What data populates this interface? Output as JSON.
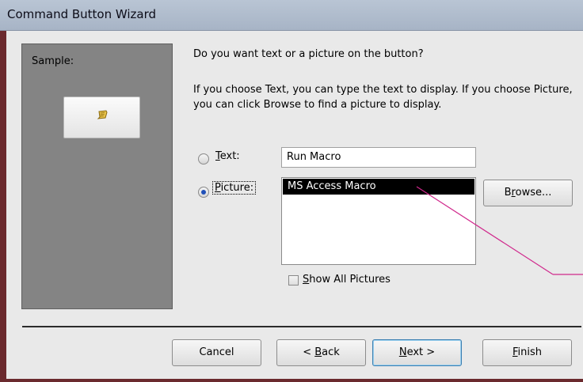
{
  "window": {
    "title": "Command Button Wizard"
  },
  "sample": {
    "label": "Sample:"
  },
  "question": "Do you want text or a picture on the button?",
  "info": "If you choose Text, you can type the text to display.  If you choose Picture, you can click Browse to find a picture to display.",
  "options": {
    "text": {
      "label": "Text:",
      "accel": "T",
      "rest": "ext:",
      "value": "Run Macro",
      "selected": false
    },
    "picture": {
      "label": "Picture:",
      "accel": "P",
      "rest": "icture:",
      "selected": true
    }
  },
  "picture_list": {
    "items": [
      "MS Access Macro"
    ],
    "selected": "MS Access Macro"
  },
  "browse_button": {
    "label": "Browse...",
    "pre": "B",
    "accel": "r",
    "post": "owse..."
  },
  "show_all": {
    "label": "Show All Pictures",
    "accel": "S",
    "rest": "how All Pictures",
    "checked": false
  },
  "footer": {
    "cancel": "Cancel",
    "back": {
      "label": "< Back",
      "pre": "< ",
      "accel": "B",
      "post": "ack"
    },
    "next": {
      "label": "Next >",
      "accel": "N",
      "post": "ext >"
    },
    "finish": {
      "label": "Finish",
      "accel": "F",
      "post": "inish"
    }
  },
  "colors": {
    "title_bar": "#a7b4c6",
    "frame": "#6b2a2e",
    "sample_panel": "#848484",
    "annotation_line": "#d0288c"
  }
}
